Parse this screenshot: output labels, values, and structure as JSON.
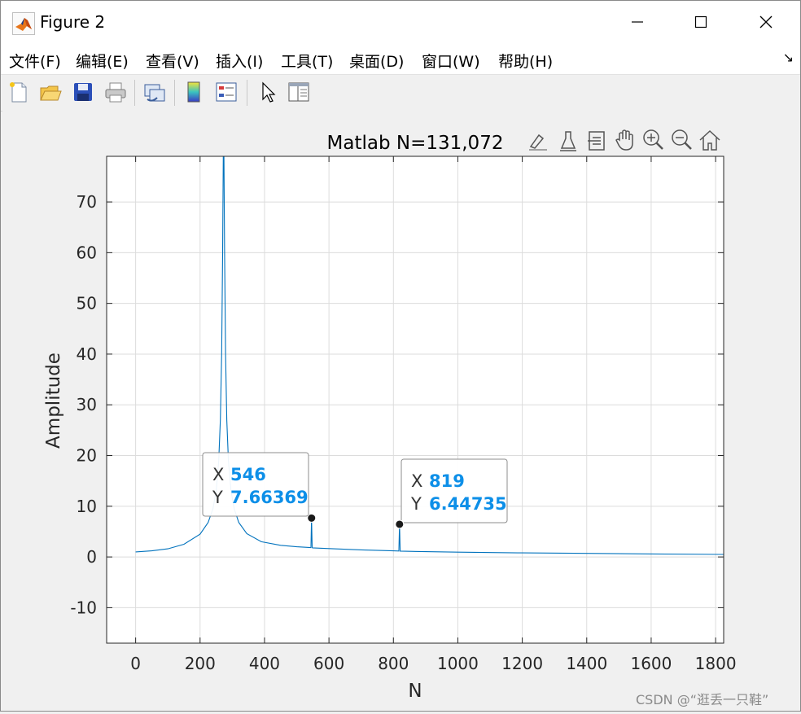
{
  "window": {
    "title": "Figure 2",
    "minimize_icon": "minimize-icon",
    "maximize_icon": "maximize-icon",
    "close_icon": "close-icon"
  },
  "menu": {
    "items": [
      "文件(F)",
      "编辑(E)",
      "查看(V)",
      "插入(I)",
      "工具(T)",
      "桌面(D)",
      "窗口(W)",
      "帮助(H)"
    ],
    "dock_icon": "dock-arrow-icon",
    "dock_glyph": "↘"
  },
  "toolbar": {
    "icons": [
      "new-figure-icon",
      "open-file-icon",
      "save-icon",
      "print-icon",
      "link-plot-icon",
      "colorbar-icon",
      "legend-icon",
      "select-pointer-icon",
      "property-inspector-icon"
    ]
  },
  "axes_toolbar": {
    "icons": [
      "brush-icon",
      "data-tip-icon",
      "rotate-icon",
      "pan-hand-icon",
      "zoom-in-icon",
      "zoom-out-icon",
      "home-icon"
    ]
  },
  "colors": {
    "line": "#0072bd",
    "datatip_value": "#0d8fe8",
    "datatip_label": "#333333"
  },
  "chart_data": {
    "type": "line",
    "title": "Matlab N=131,072",
    "xlabel": "N",
    "ylabel": "Amplitude",
    "xlim": [
      -90,
      1825
    ],
    "ylim": [
      -17,
      79
    ],
    "xticks": [
      0,
      200,
      400,
      600,
      800,
      1000,
      1200,
      1400,
      1600,
      1800
    ],
    "yticks": [
      -10,
      0,
      10,
      20,
      30,
      40,
      50,
      60,
      70
    ],
    "grid": true,
    "series": [
      {
        "peak_x": 273,
        "points": [
          [
            0,
            1.0
          ],
          [
            50,
            1.2
          ],
          [
            100,
            1.6
          ],
          [
            150,
            2.5
          ],
          [
            200,
            4.5
          ],
          [
            225,
            6.8
          ],
          [
            240,
            9.5
          ],
          [
            250,
            13
          ],
          [
            258,
            19
          ],
          [
            263,
            27
          ],
          [
            267,
            40
          ],
          [
            270,
            60
          ],
          [
            272,
            79
          ],
          [
            274,
            79
          ],
          [
            276,
            60
          ],
          [
            279,
            40
          ],
          [
            283,
            27
          ],
          [
            288,
            19
          ],
          [
            296,
            13
          ],
          [
            306,
            9.5
          ],
          [
            320,
            6.8
          ],
          [
            345,
            4.6
          ],
          [
            390,
            3.0
          ],
          [
            450,
            2.3
          ],
          [
            500,
            2.0
          ],
          [
            543,
            1.85
          ],
          [
            544,
            1.85
          ],
          [
            546,
            7.66369
          ],
          [
            548,
            1.85
          ],
          [
            549,
            1.8
          ],
          [
            600,
            1.65
          ],
          [
            700,
            1.4
          ],
          [
            800,
            1.2
          ],
          [
            817,
            1.18
          ],
          [
            819,
            6.44735
          ],
          [
            821,
            1.15
          ],
          [
            900,
            1.05
          ],
          [
            1000,
            0.95
          ],
          [
            1200,
            0.8
          ],
          [
            1400,
            0.7
          ],
          [
            1600,
            0.6
          ],
          [
            1825,
            0.5
          ]
        ]
      }
    ],
    "datatips": [
      {
        "x_label": "X",
        "x_value": "546",
        "y_label": "Y",
        "y_value": "7.66369",
        "x": 546,
        "y": 7.66369
      },
      {
        "x_label": "X",
        "x_value": "819",
        "y_label": "Y",
        "y_value": "6.44735",
        "x": 819,
        "y": 6.44735
      }
    ]
  },
  "watermark": "CSDN @“逛丢一只鞋”"
}
